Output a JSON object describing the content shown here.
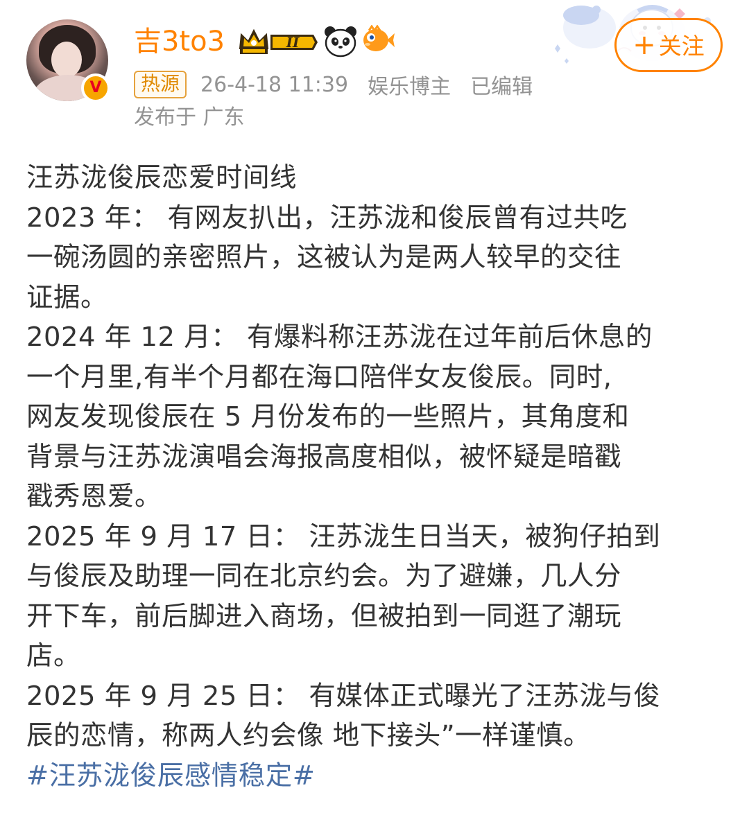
{
  "header": {
    "username": "吉3to3",
    "verified_badge": "V",
    "badges": [
      "crown-level-badge",
      "panda-icon",
      "fish-icon"
    ],
    "crown_level": "II",
    "follow_button": "关注",
    "follow_plus": "+",
    "hot_tag": "热源",
    "timestamp": "26-4-18 11:39",
    "role": "娱乐博主",
    "edited": "已编辑",
    "location": "发布于 广东"
  },
  "post": {
    "lines": [
      "汪苏泷俊辰恋爱时间线",
      "2023 年： 有网友扒出，汪苏泷和俊辰曾有过共吃",
      "一碗汤圆的亲密照片，这被认为是两人较早的交往",
      "证据。",
      "2024 年 12 月： 有爆料称汪苏泷在过年前后休息的",
      "一个月里,有半个月都在海口陪伴女友俊辰。同时,",
      "网友发现俊辰在 5 月份发布的一些照片，其角度和",
      "背景与汪苏泷演唱会海报高度相似，被怀疑是暗戳",
      "戳秀恩爱。",
      "2025 年 9 月 17 日： 汪苏泷生日当天，被狗仔拍到",
      "与俊辰及助理一同在北京约会。为了避嫌，几人分",
      "开下车，前后脚进入商场，但被拍到一同逛了潮玩",
      "店。",
      "2025 年 9 月 25 日： 有媒体正式曝光了汪苏泷与俊",
      "辰的恋情，称两人约会像 地下接头”一样谨慎。"
    ],
    "hashtag": "#汪苏泷俊辰感情稳定#"
  },
  "colors": {
    "brand_orange": "#ff8200",
    "meta_gray": "#939393",
    "text": "#333333",
    "hashtag_blue": "#4a6fa5"
  }
}
